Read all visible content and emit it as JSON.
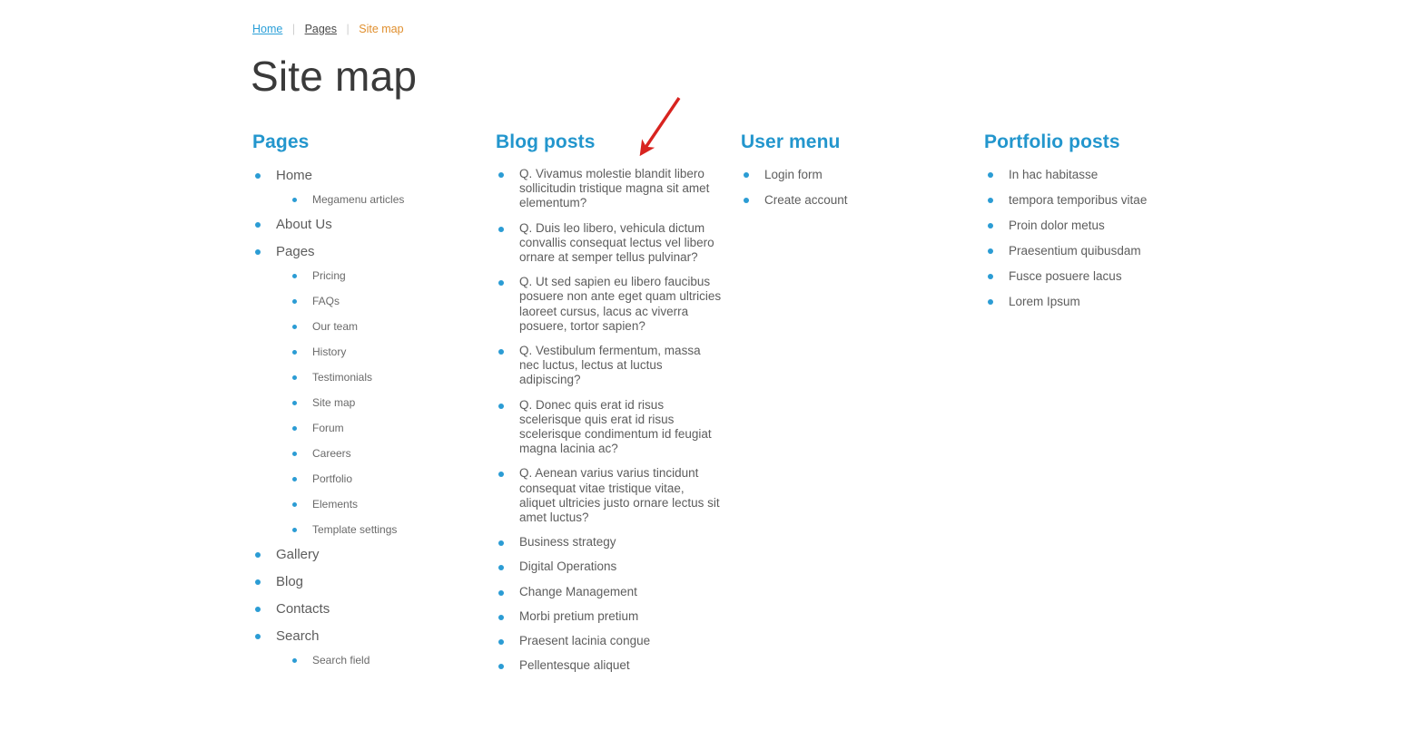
{
  "breadcrumb": {
    "items": [
      {
        "label": "Home",
        "type": "link"
      },
      {
        "label": "Pages",
        "type": "plain"
      },
      {
        "label": "Site map",
        "type": "current"
      }
    ],
    "separator": "|"
  },
  "page_title": "Site map",
  "colors": {
    "heading_blue": "#2396cd",
    "bullet_blue": "#2b9cd4",
    "breadcrumb_link": "#2a9fd8",
    "breadcrumb_current": "#e08f2e",
    "body_text": "#5d5d5d",
    "title_text": "#3a3a3a",
    "annotation_red": "#d8231f"
  },
  "columns": {
    "pages": {
      "title": "Pages",
      "items": [
        {
          "label": "Home",
          "children": [
            {
              "label": "Megamenu articles"
            }
          ]
        },
        {
          "label": "About Us",
          "children": []
        },
        {
          "label": "Pages",
          "children": [
            {
              "label": "Pricing"
            },
            {
              "label": "FAQs"
            },
            {
              "label": "Our team"
            },
            {
              "label": "History"
            },
            {
              "label": "Testimonials"
            },
            {
              "label": "Site map"
            },
            {
              "label": "Forum"
            },
            {
              "label": "Careers"
            },
            {
              "label": "Portfolio"
            },
            {
              "label": "Elements"
            },
            {
              "label": "Template settings"
            }
          ]
        },
        {
          "label": "Gallery",
          "children": []
        },
        {
          "label": "Blog",
          "children": []
        },
        {
          "label": "Contacts",
          "children": []
        },
        {
          "label": "Search",
          "children": [
            {
              "label": "Search field"
            }
          ]
        }
      ]
    },
    "blog_posts": {
      "title": "Blog posts",
      "items": [
        {
          "label": "Q. Vivamus molestie blandit libero sollicitudin tristique magna sit amet elementum?"
        },
        {
          "label": "Q. Duis leo libero, vehicula dictum convallis consequat lectus vel libero ornare at semper tellus pulvinar?"
        },
        {
          "label": "Q. Ut sed sapien eu libero faucibus posuere non ante eget quam ultricies laoreet cursus, lacus ac viverra posuere, tortor sapien?"
        },
        {
          "label": "Q. Vestibulum fermentum, massa nec luctus, lectus at luctus adipiscing?"
        },
        {
          "label": "Q. Donec quis erat id risus scelerisque quis erat id risus scelerisque condimentum id feugiat magna lacinia ac?"
        },
        {
          "label": "Q. Aenean varius varius tincidunt consequat vitae tristique vitae, aliquet ultricies justo ornare lectus sit amet luctus?"
        },
        {
          "label": "Business strategy"
        },
        {
          "label": "Digital Operations"
        },
        {
          "label": "Change Management"
        },
        {
          "label": "Morbi pretium pretium"
        },
        {
          "label": "Praesent lacinia congue"
        },
        {
          "label": "Pellentesque aliquet"
        }
      ]
    },
    "user_menu": {
      "title": "User menu",
      "items": [
        {
          "label": "Login form"
        },
        {
          "label": "Create account"
        }
      ]
    },
    "portfolio_posts": {
      "title": "Portfolio posts",
      "items": [
        {
          "label": "In hac habitasse"
        },
        {
          "label": "tempora temporibus vitae"
        },
        {
          "label": "Proin dolor metus"
        },
        {
          "label": "Praesentium quibusdam"
        },
        {
          "label": "Fusce posuere lacus"
        },
        {
          "label": "Lorem Ipsum"
        }
      ]
    }
  },
  "annotation": {
    "type": "arrow",
    "points_to": "Blog posts heading",
    "color": "#d8231f"
  }
}
